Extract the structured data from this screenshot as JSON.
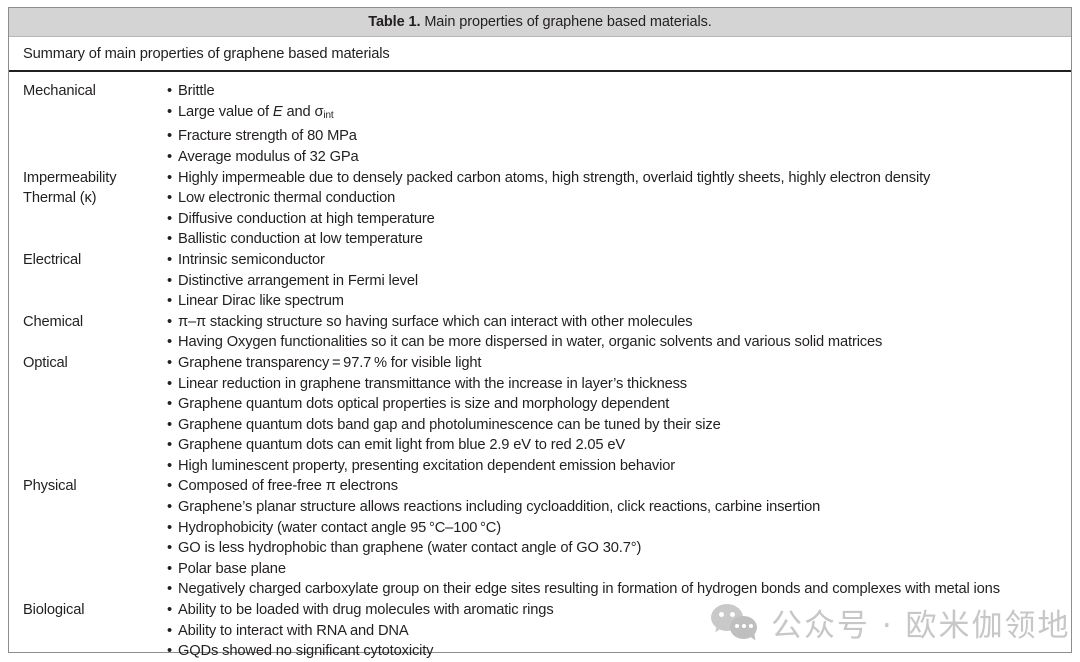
{
  "caption": {
    "label": "Table 1.",
    "text": "Main properties of graphene based materials."
  },
  "summary": "Summary of main properties of graphene based materials",
  "rows": [
    {
      "label": "Mechanical",
      "items": [
        "Brittle",
        "Large value of E and σint",
        "Fracture strength of 80 MPa",
        "Average modulus of 32 GPa"
      ]
    },
    {
      "label": "Impermeability",
      "items": [
        "Highly impermeable due to densely packed carbon atoms, high strength, overlaid tightly sheets, highly electron density"
      ]
    },
    {
      "label": "Thermal (κ)",
      "items": [
        "Low electronic thermal conduction",
        "Diffusive conduction at high temperature",
        "Ballistic conduction at low temperature"
      ]
    },
    {
      "label": "Electrical",
      "items": [
        "Intrinsic semiconductor",
        "Distinctive arrangement in Fermi level",
        "Linear Dirac like spectrum"
      ]
    },
    {
      "label": "Chemical",
      "items": [
        "π–π stacking structure so having surface which can interact with other molecules",
        "Having Oxygen functionalities so it can be more dispersed in water, organic solvents and various solid matrices"
      ]
    },
    {
      "label": "Optical",
      "items": [
        "Graphene transparency = 97.7 % for visible light",
        "Linear reduction in graphene transmittance with the increase in layer’s thickness",
        "Graphene quantum dots optical properties is size and morphology dependent",
        "Graphene quantum dots band gap and photoluminescence can be tuned by their size",
        "Graphene quantum dots can emit light from blue 2.9 eV to red 2.05 eV",
        "High luminescent property, presenting excitation dependent emission behavior"
      ]
    },
    {
      "label": "Physical",
      "items": [
        "Composed of free-free π electrons",
        "Graphene’s planar structure allows reactions including cycloaddition, click reactions, carbine insertion",
        "Hydrophobicity (water contact angle 95 °C–100 °C)",
        "GO is less hydrophobic than graphene (water contact angle of GO 30.7°)",
        "Polar base plane",
        "Negatively charged carboxylate group on their edge sites resulting in formation of hydrogen bonds and complexes with metal ions"
      ]
    },
    {
      "label": "Biological",
      "items": [
        "Ability to be loaded with drug molecules with aromatic rings",
        "Ability to interact with RNA and DNA",
        "GQDs showed no significant cytotoxicity"
      ]
    }
  ],
  "watermark": {
    "icon": "wechat-icon",
    "text": "公众号 · 欧米伽领地"
  },
  "colors": {
    "caption_band": "#d4d4d4",
    "text": "#231f20",
    "frame_border": "#8d8d8d",
    "rule": "#231f20",
    "watermark": "#c7c7c7"
  }
}
